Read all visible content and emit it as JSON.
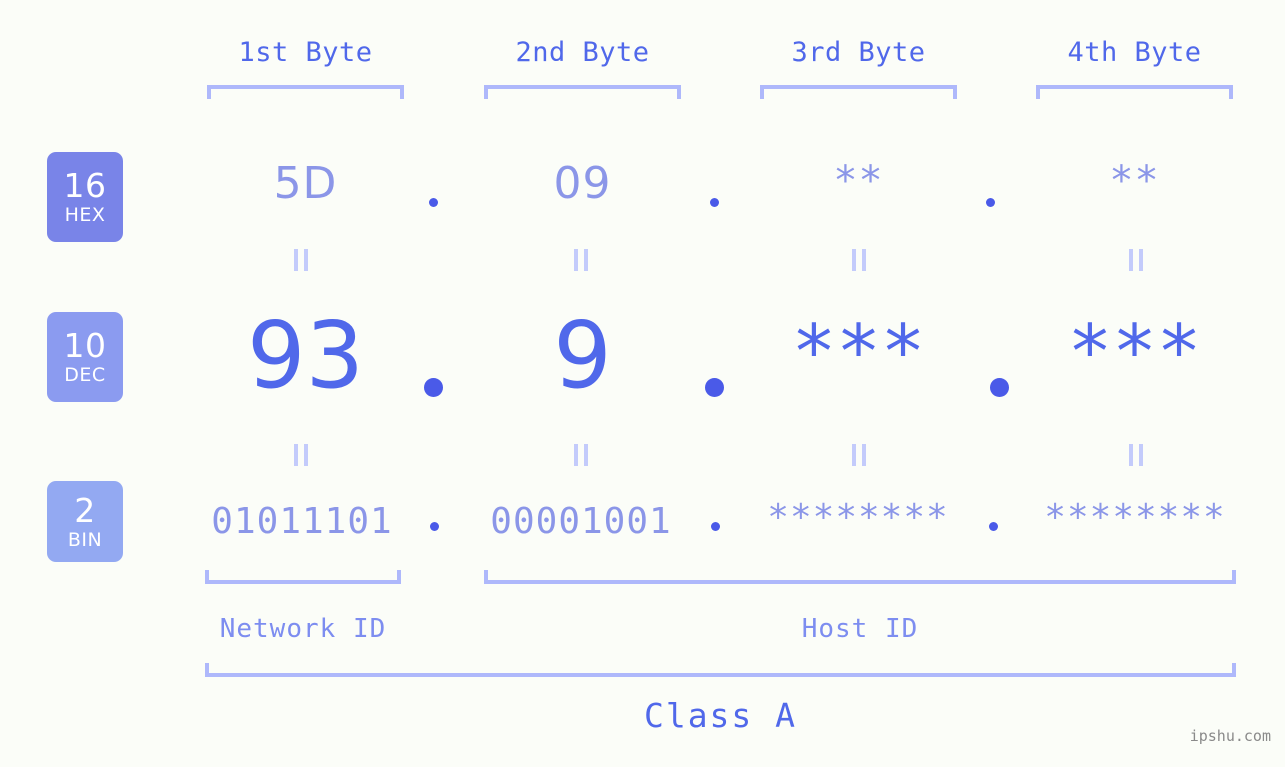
{
  "page": {
    "background_color": "#fbfdf8",
    "accent_color": "#5068ea",
    "light_accent_color": "#8b96e8",
    "bracket_color": "#aeb8fb",
    "watermark": "ipshu.com"
  },
  "byte_headers": [
    {
      "label": "1st Byte"
    },
    {
      "label": "2nd Byte"
    },
    {
      "label": "3rd Byte"
    },
    {
      "label": "4th Byte"
    }
  ],
  "radix_badges": [
    {
      "number": "16",
      "base": "HEX",
      "color": "#7984e8"
    },
    {
      "number": "10",
      "base": "DEC",
      "color": "#8b9bf0"
    },
    {
      "number": "2",
      "base": "BIN",
      "color": "#93a9f2"
    }
  ],
  "rows": {
    "hex": {
      "name": "HEX",
      "values": [
        "5D",
        "09",
        "**",
        "**"
      ],
      "separator": "."
    },
    "dec": {
      "name": "DEC",
      "values": [
        "93",
        "9",
        "***",
        "***"
      ],
      "separator": "."
    },
    "bin": {
      "name": "BIN",
      "values": [
        "01011101",
        "00001001",
        "********",
        "********"
      ],
      "separator": "."
    }
  },
  "equals_marker": "=",
  "segments": {
    "network_id": "Network ID",
    "host_id": "Host ID",
    "class": "Class A"
  }
}
